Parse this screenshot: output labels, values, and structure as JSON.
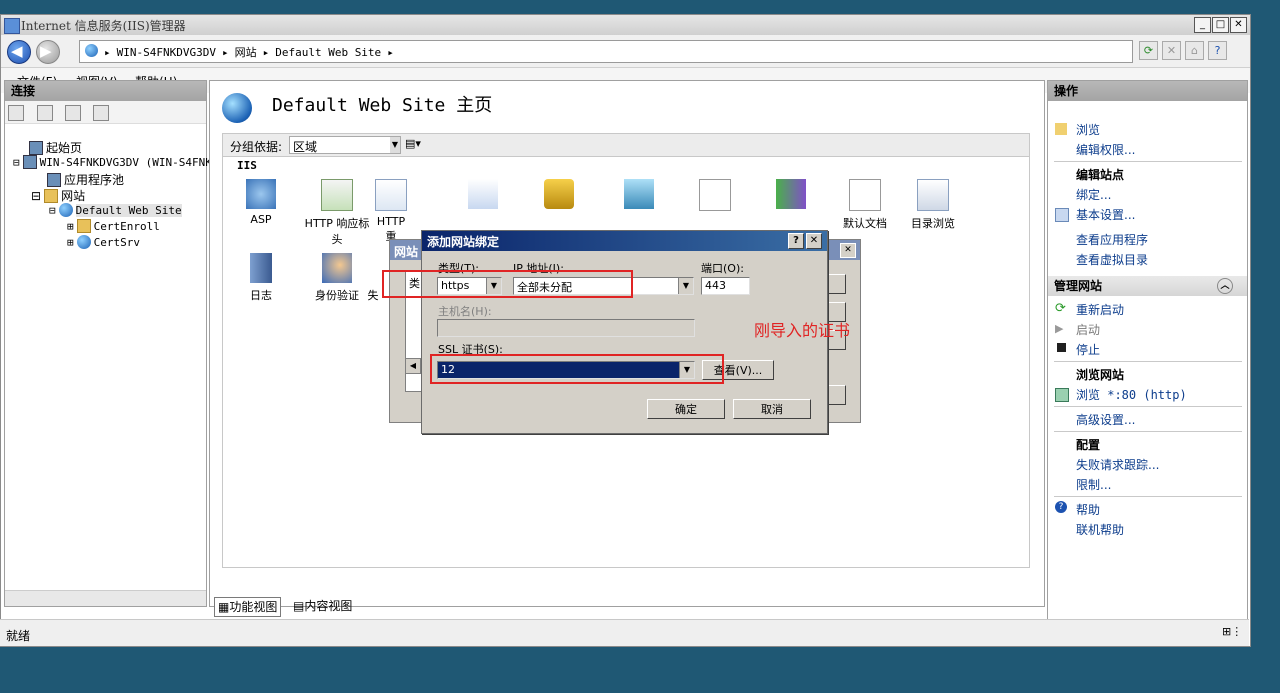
{
  "window": {
    "title": "Internet 信息服务(IIS)管理器",
    "controls": [
      "_",
      "□",
      "✕"
    ]
  },
  "nav": {
    "breadcrumbs": [
      "WIN-S4FNKDVG3DV",
      "网站",
      "Default Web Site"
    ],
    "toolbar_icons": [
      "refresh-icon",
      "stop-icon",
      "home-icon",
      "help-icon"
    ]
  },
  "menu": {
    "file": "文件(F)",
    "view": "视图(V)",
    "help": "帮助(H)"
  },
  "connections": {
    "header": "连接",
    "tree": {
      "start": "起始页",
      "server": "WIN-S4FNKDVG3DV (WIN-S4FNK",
      "apppools": "应用程序池",
      "sites": "网站",
      "default_site": "Default Web Site",
      "certenroll": "CertEnroll",
      "certsrv": "CertSrv"
    }
  },
  "center": {
    "title": "Default Web Site 主页",
    "group_label": "分组依据:",
    "group_value": "区域",
    "section": "IIS",
    "features": {
      "asp": "ASP",
      "http_resp": "HTTP 响应标头",
      "http_redirect": "HTTP 重",
      "error": "默认文档",
      "dirbrowse": "目录浏览",
      "log": "日志",
      "auth": "身份验证",
      "fail": "失"
    },
    "tabs": {
      "feature_view": "功能视图",
      "content_view": "内容视图"
    }
  },
  "actions": {
    "header": "操作",
    "browse": "浏览",
    "edit_perm": "编辑权限...",
    "edit_site_head": "编辑站点",
    "bindings": "绑定...",
    "basic_settings": "基本设置...",
    "view_apps": "查看应用程序",
    "view_vdirs": "查看虚拟目录",
    "manage_head": "管理网站",
    "restart": "重新启动",
    "start": "启动",
    "stop": "停止",
    "browse_site_head": "浏览网站",
    "browse_80": "浏览 *:80 (http)",
    "advanced": "高级设置...",
    "config_head": "配置",
    "failed_trace": "失败请求跟踪...",
    "limits": "限制...",
    "help": "帮助",
    "online_help": "联机帮助"
  },
  "status": {
    "text": "就绪"
  },
  "back_dialog": {
    "title": "网站",
    "type_label": "类"
  },
  "dialog": {
    "title": "添加网站绑定",
    "type_label": "类型(T):",
    "type_value": "https",
    "ip_label": "IP 地址(I):",
    "ip_value": "全部未分配",
    "port_label": "端口(O):",
    "port_value": "443",
    "host_label": "主机名(H):",
    "host_value": "",
    "ssl_label": "SSL 证书(S):",
    "ssl_value": "12",
    "view_button": "查看(V)...",
    "ok": "确定",
    "cancel": "取消"
  },
  "annotation": {
    "text": "刚导入的证书",
    "color": "#e02424"
  }
}
